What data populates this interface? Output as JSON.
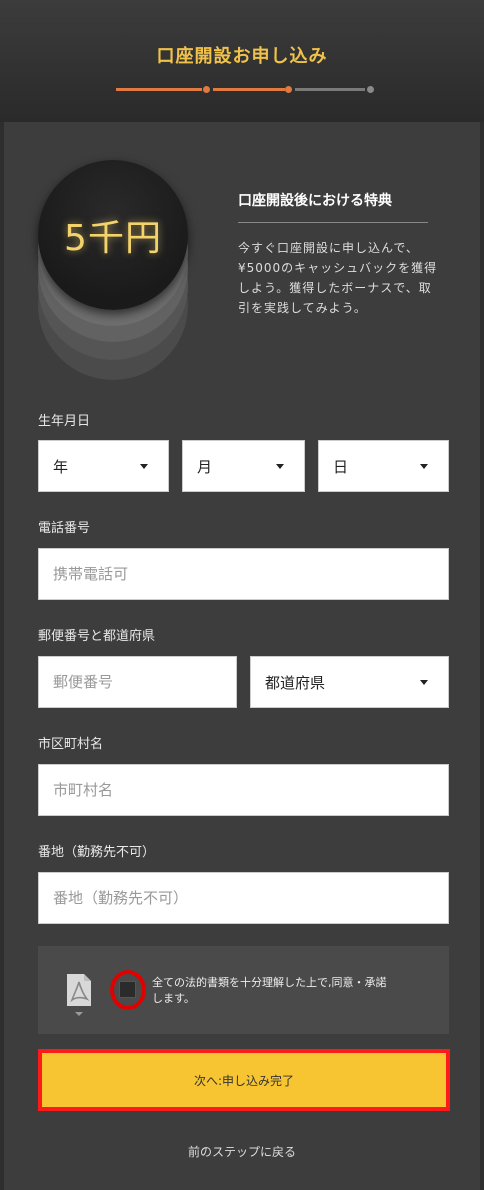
{
  "header": {
    "title": "口座開設お申し込み",
    "accent_color": "#e07a3e",
    "title_color": "#f1c24a"
  },
  "promo": {
    "coin_text": "5千円",
    "title": "口座開設後における特典",
    "description": "今すぐ口座開設に申し込んで、¥5000のキャッシュバックを獲得しよう。獲得したボーナスで、取引を実践してみよう。"
  },
  "birthdate": {
    "label": "生年月日",
    "year": "年",
    "month": "月",
    "day": "日"
  },
  "phone": {
    "label": "電話番号",
    "placeholder": "携帯電話可"
  },
  "postal": {
    "label": "郵便番号と都道府県",
    "placeholder": "郵便番号",
    "prefecture": "都道府県"
  },
  "city": {
    "label": "市区町村名",
    "placeholder": "市町村名"
  },
  "address": {
    "label": "番地（勤務先不可）",
    "placeholder": "番地（勤務先不可）"
  },
  "agreement": {
    "text": "全ての法的書類を十分理解した上で,同意・承諾します。",
    "icon": "pdf-icon",
    "checked": false
  },
  "actions": {
    "next_label": "次へ:申し込み完了",
    "back_label": "前のステップに戻る",
    "button_color": "#f7c531"
  }
}
